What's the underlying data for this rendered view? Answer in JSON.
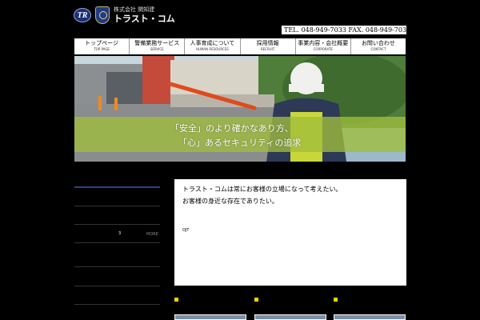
{
  "header": {
    "logo_mark": "TR",
    "company_sub": "株式会社 関知建",
    "company_name": "トラスト・コム",
    "tel_fax": "TEL. 048-949-7033  FAX. 048-949-7034"
  },
  "nav": {
    "items": [
      {
        "label": "トップページ",
        "sub": "TOP PAGE"
      },
      {
        "label": "警備業務サービス",
        "sub": "SERVICE"
      },
      {
        "label": "人事育成について",
        "sub": "HUMAN RESOURCES"
      },
      {
        "label": "採用情報",
        "sub": "RECRUIT"
      },
      {
        "label": "事業内容・会社概要",
        "sub": "CORPORATE"
      },
      {
        "label": "お問い合わせ",
        "sub": "CONTACT"
      }
    ]
  },
  "hero": {
    "line1": "「安全」のより確かなあり方、",
    "line2": "「心」あるセキュリティの追求"
  },
  "sidebar": {
    "number": "3",
    "more": "MORE"
  },
  "content": {
    "line1": "トラスト・コムは常にお客様の立場になって考えたい。",
    "line2": "お客様の身近な存在でありたい。",
    "ojt": "OJT"
  },
  "colors": {
    "accent_yellow": "#f5d000",
    "nav_blue": "#1b2f74",
    "hero_band": "#a0be3c"
  }
}
